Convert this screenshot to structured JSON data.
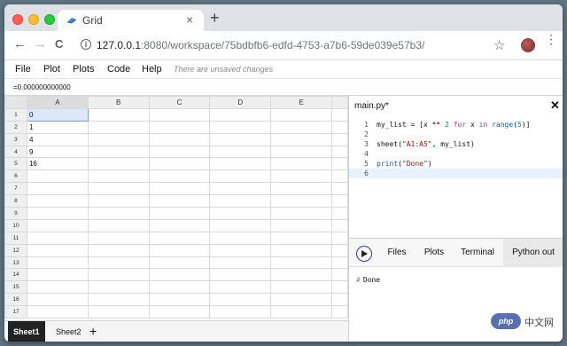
{
  "browser": {
    "tab_title": "Grid",
    "new_tab_symbol": "+",
    "close_symbol": "×",
    "url_host": "127.0.0.1",
    "url_path": ":8080/workspace/75bdbfb6-edfd-4753-a7b6-59de039e57b3/",
    "back_icon": "←",
    "forward_icon": "→",
    "reload_icon": "C",
    "info_icon": "i",
    "star_icon": "☆",
    "menu_icon": "⋮"
  },
  "menu": {
    "items": [
      "File",
      "Plot",
      "Plots",
      "Code",
      "Help"
    ],
    "status": "There are unsaved changes"
  },
  "formula_bar": {
    "value": "=0.000000000000"
  },
  "sheet": {
    "columns": [
      "A",
      "B",
      "C",
      "D",
      "E"
    ],
    "rows": [
      "1",
      "2",
      "3",
      "4",
      "5",
      "6",
      "7",
      "8",
      "9",
      "10",
      "11",
      "12",
      "13",
      "14",
      "15",
      "16",
      "17"
    ],
    "col_a_values": [
      "0",
      "1",
      "4",
      "9",
      "16"
    ],
    "tabs": [
      "Sheet1",
      "Sheet2"
    ],
    "add_symbol": "+"
  },
  "editor": {
    "filename": "main.py*",
    "close_symbol": "✕",
    "line_numbers": [
      "1",
      "2",
      "3",
      "4",
      "5",
      "6"
    ],
    "lines": [
      "my_list = [x ** 2 for x in range(5)]",
      "",
      "sheet(\"A1:A5\", my_list)",
      "",
      "print(\"Done\")",
      ""
    ],
    "current_line": 6
  },
  "panel": {
    "tabs": [
      "Files",
      "Plots",
      "Terminal",
      "Python out"
    ],
    "active_tab": "Python out",
    "output_prefix": "#",
    "output": "Done"
  },
  "watermark": {
    "logo": "php",
    "text": "中文网"
  },
  "colors": {
    "active_cell": "#dce8f8",
    "run_button_ring": "#3a3a9a",
    "close_light": "#ff5f57",
    "min_light": "#febc2e",
    "max_light": "#28c840"
  }
}
